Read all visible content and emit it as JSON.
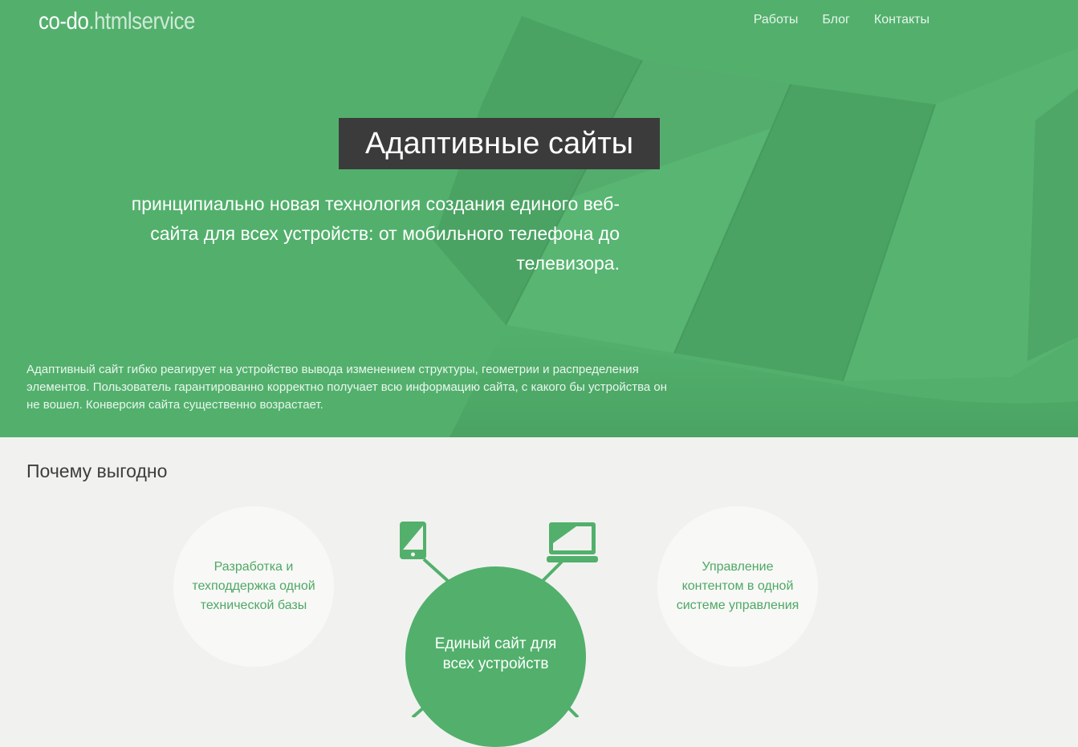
{
  "logo": {
    "part1": "co-do",
    "part2": ".htmlservice"
  },
  "nav": {
    "items": [
      "Работы",
      "Блог",
      "Контакты"
    ]
  },
  "hero": {
    "title": "Адаптивные сайты",
    "subtitle": "принципиально новая технология создания единого веб-сайта для всех устройств: от мобильного телефона до телевизора.",
    "description": "Адаптивный сайт гибко реагирует на устройство вывода изменением структуры, геометрии и распределения элементов. Пользователь гарантированно корректно получает всю информацию сайта, с какого бы устройства он не вошел. Конверсия сайта существенно возрастает."
  },
  "benefits": {
    "title": "Почему выгодно",
    "left": "Разработка и техподдержка одной технической базы",
    "center": "Единый сайт для всех устройств",
    "right": "Управление контентом в одной системе управления",
    "icons": [
      "tablet-icon",
      "laptop-icon"
    ]
  },
  "colors": {
    "green": "#52b06c",
    "dark": "#3b3b3b",
    "light_bg": "#f1f2ef"
  }
}
